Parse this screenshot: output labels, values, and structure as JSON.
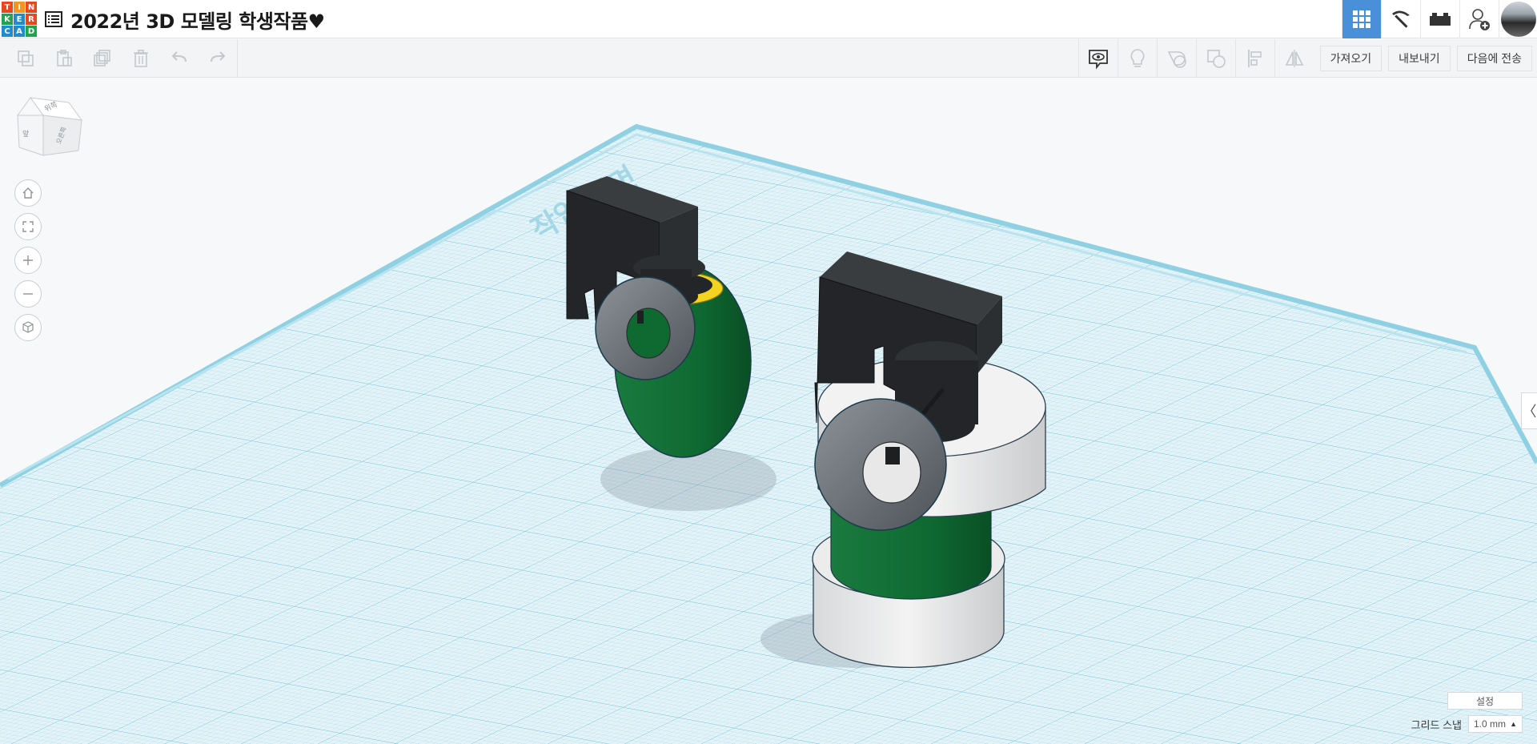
{
  "app": {
    "logo_letters": [
      "T",
      "I",
      "N",
      "K",
      "E",
      "R",
      "C",
      "A",
      "D"
    ],
    "logo_colors": [
      "#e8481e",
      "#f7941d",
      "#e8481e",
      "#1fa64b",
      "#1f8bd1",
      "#e8481e",
      "#1f8bd1",
      "#1f8bd1",
      "#1fa64b"
    ],
    "title": "2022년 3D 모델링 학생작품♥"
  },
  "topbar": {
    "buttons": [
      {
        "name": "3d-view-grid-icon",
        "active": true
      },
      {
        "name": "pickaxe-icon",
        "active": false
      },
      {
        "name": "bricks-icon",
        "active": false
      },
      {
        "name": "add-user-icon",
        "active": false
      }
    ],
    "accent": "#4a90d9"
  },
  "toolbar": {
    "import_label": "가져오기",
    "export_label": "내보내기",
    "send_label": "다음에 전송"
  },
  "viewcube": {
    "top": "위쪽",
    "front": "앞",
    "side": "오른쪽"
  },
  "workplane": {
    "label": "작업 평면"
  },
  "settings": {
    "settings_label": "설정",
    "snap_label": "그리드 스냅",
    "snap_value": "1.0 mm"
  }
}
